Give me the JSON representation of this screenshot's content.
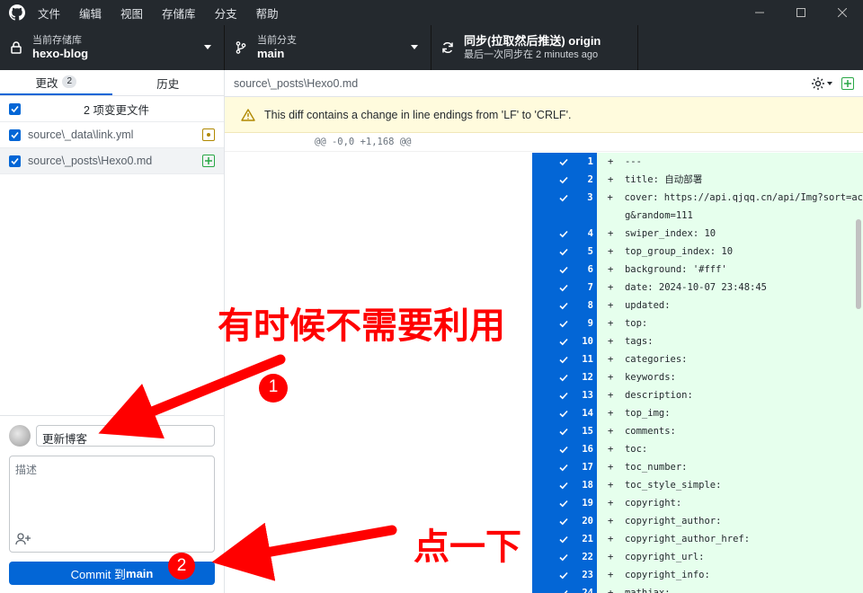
{
  "menu": [
    "文件",
    "编辑",
    "视图",
    "存储库",
    "分支",
    "帮助"
  ],
  "toolbar": {
    "repo_caption": "当前存储库",
    "repo_name": "hexo-blog",
    "branch_caption": "当前分支",
    "branch_name": "main",
    "sync_title": "同步(拉取然后推送) origin",
    "sync_sub": "最后一次同步在 2 minutes ago"
  },
  "tabs": {
    "changes": "更改",
    "changes_count": "2",
    "history": "历史"
  },
  "files": {
    "header": "2 项变更文件",
    "items": [
      "source\\_data\\link.yml",
      "source\\_posts\\Hexo0.md"
    ]
  },
  "commit": {
    "summary": "更新博客",
    "description_placeholder": "描述",
    "button_prefix": "Commit 到 ",
    "button_branch": "main"
  },
  "diff": {
    "path": "source\\_posts\\Hexo0.md",
    "warning": "This diff contains a change in line endings from 'LF' to 'CRLF'.",
    "hunk": "@@ -0,0 +1,168 @@",
    "lines": [
      {
        "n": "1",
        "t": "+  ---"
      },
      {
        "n": "2",
        "t": "+  title: 自动部署"
      },
      {
        "n": "3",
        "t": "+  cover: https://api.qjqq.cn/api/Img?sort=ac"
      },
      {
        "n": "",
        "t": "   g&random=111"
      },
      {
        "n": "4",
        "t": "+  swiper_index: 10"
      },
      {
        "n": "5",
        "t": "+  top_group_index: 10"
      },
      {
        "n": "6",
        "t": "+  background: '#fff'"
      },
      {
        "n": "7",
        "t": "+  date: 2024-10-07 23:48:45"
      },
      {
        "n": "8",
        "t": "+  updated:"
      },
      {
        "n": "9",
        "t": "+  top:"
      },
      {
        "n": "10",
        "t": "+  tags:"
      },
      {
        "n": "11",
        "t": "+  categories:"
      },
      {
        "n": "12",
        "t": "+  keywords:"
      },
      {
        "n": "13",
        "t": "+  description:"
      },
      {
        "n": "14",
        "t": "+  top_img:"
      },
      {
        "n": "15",
        "t": "+  comments:"
      },
      {
        "n": "16",
        "t": "+  toc:"
      },
      {
        "n": "17",
        "t": "+  toc_number:"
      },
      {
        "n": "18",
        "t": "+  toc_style_simple:"
      },
      {
        "n": "19",
        "t": "+  copyright:"
      },
      {
        "n": "20",
        "t": "+  copyright_author:"
      },
      {
        "n": "21",
        "t": "+  copyright_author_href:"
      },
      {
        "n": "22",
        "t": "+  copyright_url:"
      },
      {
        "n": "23",
        "t": "+  copyright_info:"
      },
      {
        "n": "24",
        "t": "+  mathjax:"
      }
    ]
  },
  "annotations": {
    "text1": "有时候不需要利用",
    "text2": "点一下",
    "num1": "1",
    "num2": "2"
  },
  "colors": {
    "accent": "#0366d6",
    "arrow": "#ff0000",
    "added_bg": "#e6ffed"
  }
}
